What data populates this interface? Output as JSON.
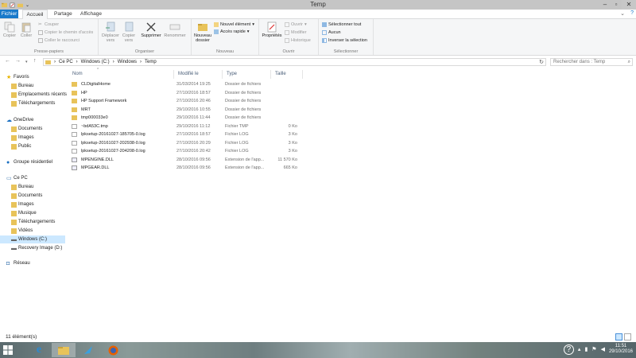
{
  "window": {
    "title": "Temp"
  },
  "tabs": {
    "file": "Fichier",
    "home": "Accueil",
    "share": "Partage",
    "view": "Affichage"
  },
  "ribbon": {
    "clipboard": {
      "label": "Presse-papiers",
      "copy": "Copier",
      "paste": "Coller",
      "cut": "Couper",
      "copy_path": "Copier le chemin d'accès",
      "paste_shortcut": "Coller le raccourci"
    },
    "organize": {
      "label": "Organiser",
      "move_to_1": "Déplacer",
      "move_to_2": "vers",
      "copy_to_1": "Copier",
      "copy_to_2": "vers",
      "delete": "Supprimer",
      "rename": "Renommer"
    },
    "new": {
      "label": "Nouveau",
      "new_folder_1": "Nouveau",
      "new_folder_2": "dossier",
      "new_item": "Nouvel élément",
      "easy_access": "Accès rapide"
    },
    "open": {
      "label": "Ouvrir",
      "properties": "Propriétés",
      "open": "Ouvrir",
      "edit": "Modifier",
      "history": "Historique"
    },
    "select": {
      "label": "Sélectionner",
      "select_all": "Sélectionner tout",
      "select_none": "Aucun",
      "invert": "Inverser la sélection"
    }
  },
  "address": {
    "crumbs": [
      "Ce PC",
      "Windows (C:)",
      "Windows",
      "Temp"
    ],
    "search_placeholder": "Rechercher dans : Temp"
  },
  "sidebar": [
    {
      "label": "Favoris",
      "icon": "star-icon",
      "level": 0
    },
    {
      "label": "Bureau",
      "icon": "desktop-icon",
      "level": 1
    },
    {
      "label": "Emplacements récents",
      "icon": "recent-places-icon",
      "level": 1
    },
    {
      "label": "Téléchargements",
      "icon": "downloads-icon",
      "level": 1
    },
    {
      "label": "OneDrive",
      "icon": "onedrive-icon",
      "level": 0
    },
    {
      "label": "Documents",
      "icon": "folder-icon",
      "level": 1
    },
    {
      "label": "Images",
      "icon": "folder-icon",
      "level": 1
    },
    {
      "label": "Public",
      "icon": "folder-icon",
      "level": 1
    },
    {
      "label": "Groupe résidentiel",
      "icon": "homegroup-icon",
      "level": 0
    },
    {
      "label": "Ce PC",
      "icon": "computer-icon",
      "level": 0
    },
    {
      "label": "Bureau",
      "icon": "desktop-icon",
      "level": 1
    },
    {
      "label": "Documents",
      "icon": "documents-icon",
      "level": 1
    },
    {
      "label": "Images",
      "icon": "pictures-icon",
      "level": 1
    },
    {
      "label": "Musique",
      "icon": "music-icon",
      "level": 1
    },
    {
      "label": "Téléchargements",
      "icon": "downloads-icon",
      "level": 1
    },
    {
      "label": "Vidéos",
      "icon": "videos-icon",
      "level": 1
    },
    {
      "label": "Windows (C:)",
      "icon": "drive-icon",
      "level": 1,
      "selected": true
    },
    {
      "label": "Recovery Image (D:)",
      "icon": "drive-icon",
      "level": 1
    },
    {
      "label": "Réseau",
      "icon": "network-icon",
      "level": 0
    }
  ],
  "columns": {
    "name": "Nom",
    "modified": "Modifié le",
    "type": "Type",
    "size": "Taille"
  },
  "files": [
    {
      "name": "CLDigitalHome",
      "modified": "31/03/2014 19:25",
      "type": "Dossier de fichiers",
      "size": "",
      "kind": "folder"
    },
    {
      "name": "HP",
      "modified": "27/10/2016 18:57",
      "type": "Dossier de fichiers",
      "size": "",
      "kind": "folder"
    },
    {
      "name": "HP Support Framework",
      "modified": "27/10/2016 20:46",
      "type": "Dossier de fichiers",
      "size": "",
      "kind": "folder"
    },
    {
      "name": "MRT",
      "modified": "29/10/2016 10:55",
      "type": "Dossier de fichiers",
      "size": "",
      "kind": "folder"
    },
    {
      "name": "tmp000033e0",
      "modified": "29/10/2016 11:44",
      "type": "Dossier de fichiers",
      "size": "",
      "kind": "folder"
    },
    {
      "name": "~bdA53C.tmp",
      "modified": "29/10/2016 11:12",
      "type": "Fichier TMP",
      "size": "0 Ko",
      "kind": "file"
    },
    {
      "name": "lpksetup-20161027-185705-0.log",
      "modified": "27/10/2016 18:57",
      "type": "Fichier LOG",
      "size": "3 Ko",
      "kind": "file"
    },
    {
      "name": "lpksetup-20161027-202938-0.log",
      "modified": "27/10/2016 20:29",
      "type": "Fichier LOG",
      "size": "3 Ko",
      "kind": "file"
    },
    {
      "name": "lpksetup-20161027-204208-0.log",
      "modified": "27/10/2016 20:42",
      "type": "Fichier LOG",
      "size": "3 Ko",
      "kind": "file"
    },
    {
      "name": "MPENGINE.DLL",
      "modified": "28/10/2016 09:56",
      "type": "Extension de l'app...",
      "size": "11 570 Ko",
      "kind": "dll"
    },
    {
      "name": "MPGEAR.DLL",
      "modified": "28/10/2016 09:56",
      "type": "Extension de l'app...",
      "size": "665 Ko",
      "kind": "dll"
    }
  ],
  "status": {
    "count": "11 élément(s)"
  },
  "clock": {
    "time": "11:51",
    "date": "29/10/2016"
  },
  "colors": {
    "accent": "#1979ca",
    "folder": "#e8c35a",
    "selection": "#cce8ff"
  }
}
